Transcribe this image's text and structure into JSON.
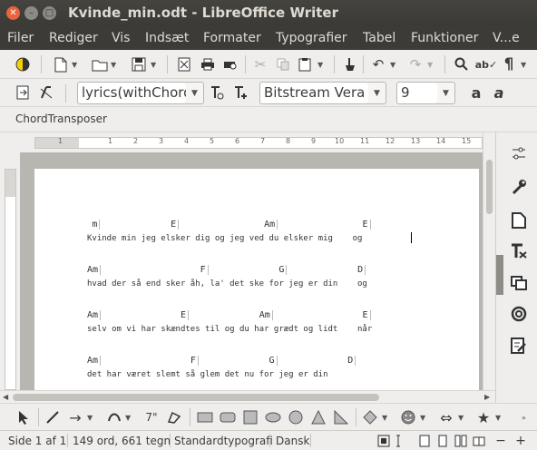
{
  "window": {
    "title": "Kvinde_min.odt - LibreOffice Writer"
  },
  "menu": {
    "items": [
      {
        "label": "Filer",
        "id": "filer"
      },
      {
        "label": "Rediger",
        "id": "rediger"
      },
      {
        "label": "Vis",
        "id": "vis"
      },
      {
        "label": "Indsæt",
        "id": "indsaet"
      },
      {
        "label": "Formater",
        "id": "formater"
      },
      {
        "label": "Typografier",
        "id": "typografier"
      },
      {
        "label": "Tabel",
        "id": "tabel"
      },
      {
        "label": "Funktioner",
        "id": "funktioner"
      },
      {
        "label": "V...e",
        "id": "vinduer"
      }
    ]
  },
  "formatting": {
    "paragraph_style": "lyrics(withChord",
    "font_name": "Bitstream Vera S",
    "font_size": "9"
  },
  "extension_toolbar": {
    "label": "ChordTransposer"
  },
  "document": {
    "verses": [
      {
        "chords": [
          {
            "text": "m",
            "col": 1
          },
          {
            "text": "E",
            "col": 17
          },
          {
            "text": "Am",
            "col": 36
          },
          {
            "text": "E",
            "col": 56
          }
        ],
        "lyric": "Kvinde min jeg elsker dig og jeg ved du elsker mig    og"
      },
      {
        "chords": [
          {
            "text": "Am",
            "col": 0
          },
          {
            "text": "F",
            "col": 23
          },
          {
            "text": "G",
            "col": 39
          },
          {
            "text": "D",
            "col": 55
          }
        ],
        "lyric": "hvad der så end sker åh, la' det ske for jeg er din    og"
      },
      {
        "chords": [
          {
            "text": "Am",
            "col": 0
          },
          {
            "text": "E",
            "col": 19
          },
          {
            "text": "Am",
            "col": 35
          },
          {
            "text": "E",
            "col": 56
          }
        ],
        "lyric": "selv om vi har skændtes til og du har grædt og lidt    når"
      },
      {
        "chords": [
          {
            "text": "Am",
            "col": 0
          },
          {
            "text": "F",
            "col": 21
          },
          {
            "text": "G",
            "col": 37
          },
          {
            "text": "D",
            "col": 53
          }
        ],
        "lyric": "det har været slemt så glem det nu for jeg er din"
      }
    ]
  },
  "ruler": {
    "numbers": [
      "1",
      "1",
      "2",
      "3",
      "4",
      "5",
      "6",
      "7",
      "8",
      "9",
      "10",
      "11",
      "12",
      "13",
      "14",
      "15"
    ]
  },
  "status": {
    "page": "Side 1 af 1",
    "words": "149 ord, 661 tegn",
    "page_style": "Standardtypografi",
    "language": "Dansk"
  },
  "colors": {
    "close_button": "#e9643a",
    "titlebar": "#3c3b37",
    "accent": "#dd4814"
  },
  "icons": {
    "standard": [
      "new-icon",
      "open-icon",
      "save-icon",
      "export-pdf-icon",
      "print-icon",
      "print-preview-icon",
      "cut-icon",
      "copy-icon",
      "paste-icon",
      "clone-formatting-icon",
      "undo-icon",
      "redo-icon",
      "find-replace-icon",
      "spellcheck-icon",
      "formatting-marks-icon"
    ],
    "sidebar": [
      "properties-icon",
      "styles-icon",
      "gallery-icon",
      "navigator-icon",
      "manage-changes-icon",
      "design-icon"
    ]
  }
}
